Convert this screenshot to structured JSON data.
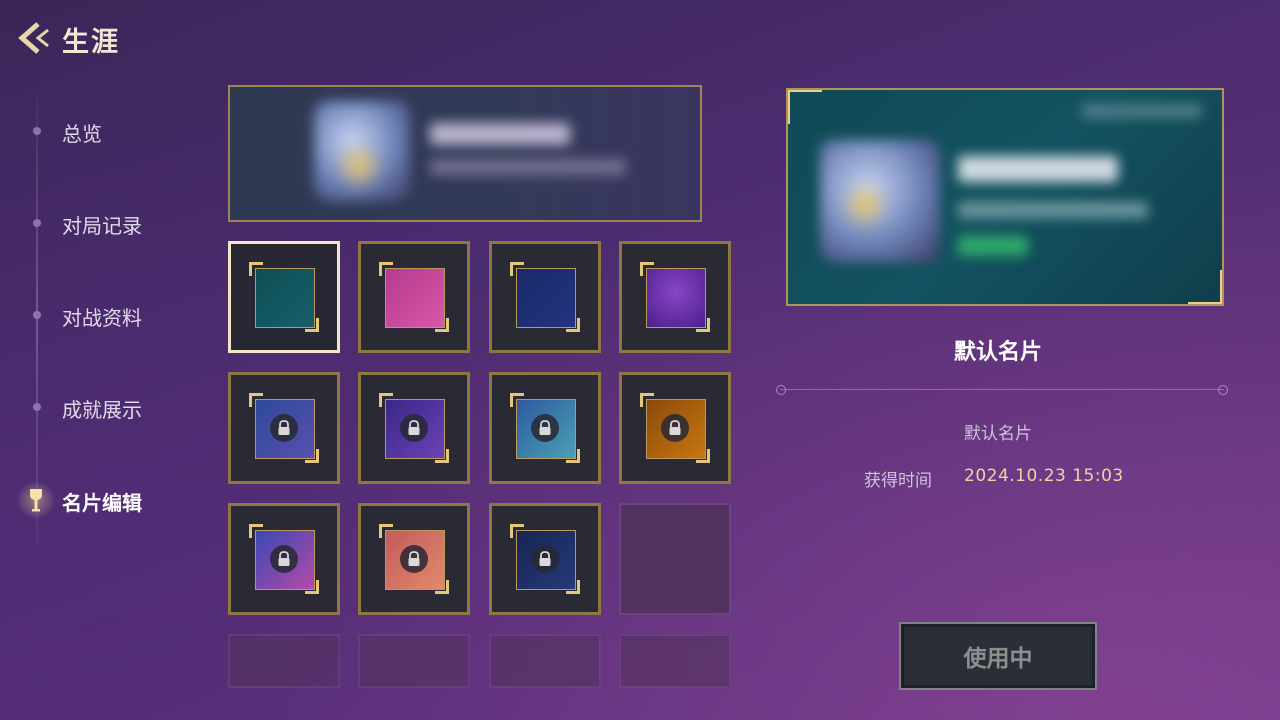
{
  "header": {
    "title": "生涯"
  },
  "sidebar": {
    "items": [
      {
        "label": "总览",
        "active": false
      },
      {
        "label": "对局记录",
        "active": false
      },
      {
        "label": "对战资料",
        "active": false
      },
      {
        "label": "成就展示",
        "active": false
      },
      {
        "label": "名片编辑",
        "active": true
      }
    ]
  },
  "grid": {
    "tiles": [
      {
        "state": "selected",
        "theme": "teal",
        "locked": false
      },
      {
        "state": "owned",
        "theme": "pink",
        "locked": false
      },
      {
        "state": "owned",
        "theme": "navy",
        "locked": false
      },
      {
        "state": "owned",
        "theme": "purple-star",
        "locked": false
      },
      {
        "state": "locked",
        "theme": "blue-crystal",
        "locked": true
      },
      {
        "state": "locked",
        "theme": "violet",
        "locked": true
      },
      {
        "state": "locked",
        "theme": "teal-gold",
        "locked": true
      },
      {
        "state": "locked",
        "theme": "amber",
        "locked": true
      },
      {
        "state": "locked",
        "theme": "ocean",
        "locked": true
      },
      {
        "state": "locked",
        "theme": "sunset",
        "locked": true
      },
      {
        "state": "locked",
        "theme": "dark-blue",
        "locked": true
      },
      {
        "state": "empty"
      },
      {
        "state": "empty"
      },
      {
        "state": "empty"
      },
      {
        "state": "empty"
      },
      {
        "state": "empty"
      }
    ]
  },
  "detail": {
    "card_name": "默认名片",
    "description": "默认名片",
    "acquired_label": "获得时间",
    "acquired_value": "2024.10.23  15:03",
    "button_label": "使用中"
  },
  "colors": {
    "gold_border": "#8f7744",
    "selected_border": "#f4e6c4",
    "accent_text": "#ecd6a0"
  }
}
